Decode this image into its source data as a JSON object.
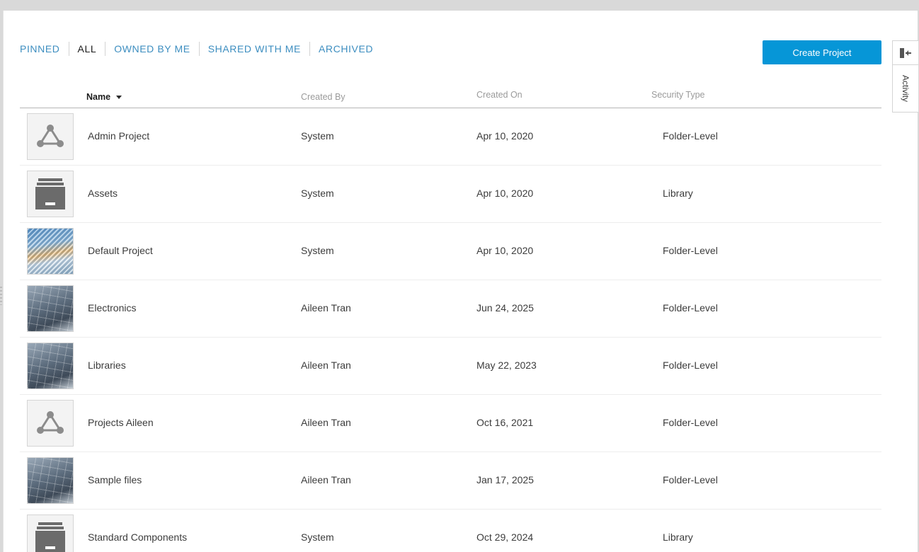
{
  "tabs": [
    {
      "label": "PINNED",
      "active": false
    },
    {
      "label": "ALL",
      "active": true
    },
    {
      "label": "OWNED BY ME",
      "active": false
    },
    {
      "label": "SHARED WITH ME",
      "active": false
    },
    {
      "label": "ARCHIVED",
      "active": false
    }
  ],
  "create_button": "Create Project",
  "side_panel": {
    "activity_label": "Activity",
    "collapse_icon": "collapse-panel-icon"
  },
  "table": {
    "columns": {
      "name": "Name",
      "created_by": "Created By",
      "created_on": "Created On",
      "security_type": "Security Type"
    },
    "sort": {
      "column": "name",
      "direction": "desc"
    },
    "rows": [
      {
        "name": "Admin Project",
        "created_by": "System",
        "created_on": "Apr 10, 2020",
        "security_type": "Folder-Level",
        "thumb": "project-network-icon"
      },
      {
        "name": "Assets",
        "created_by": "System",
        "created_on": "Apr 10, 2020",
        "security_type": "Library",
        "thumb": "archive-box-icon"
      },
      {
        "name": "Default Project",
        "created_by": "System",
        "created_on": "Apr 10, 2020",
        "security_type": "Folder-Level",
        "thumb": "sky-photo"
      },
      {
        "name": "Electronics",
        "created_by": "Aileen Tran",
        "created_on": "Jun 24, 2025",
        "security_type": "Folder-Level",
        "thumb": "solar-panel-photo"
      },
      {
        "name": "Libraries",
        "created_by": "Aileen Tran",
        "created_on": "May 22, 2023",
        "security_type": "Folder-Level",
        "thumb": "solar-panel-photo"
      },
      {
        "name": "Projects Aileen",
        "created_by": "Aileen Tran",
        "created_on": "Oct 16, 2021",
        "security_type": "Folder-Level",
        "thumb": "project-network-icon"
      },
      {
        "name": "Sample files",
        "created_by": "Aileen Tran",
        "created_on": "Jan 17, 2025",
        "security_type": "Folder-Level",
        "thumb": "solar-panel-photo"
      },
      {
        "name": "Standard Components",
        "created_by": "System",
        "created_on": "Oct 29, 2024",
        "security_type": "Library",
        "thumb": "archive-box-icon"
      }
    ]
  },
  "colors": {
    "accent": "#0696d7",
    "tab_link": "#3d8ec0",
    "icon_gray": "#8c8c8c"
  }
}
